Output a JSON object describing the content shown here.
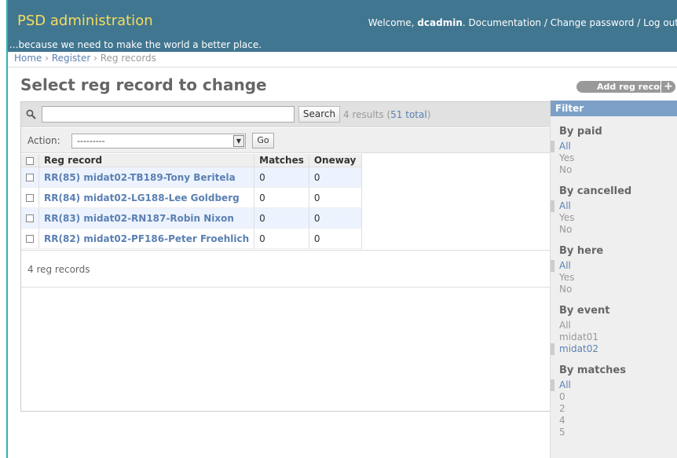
{
  "header": {
    "brand": "PSD administration",
    "tagline": "...because we need to make the world a better place.",
    "welcome": "Welcome, ",
    "username": "dcadmin",
    "links": "Documentation / Change password / Log out"
  },
  "breadcrumbs": {
    "home": "Home",
    "register": "Register",
    "current": "Reg records",
    "sep": " › "
  },
  "page": {
    "title": "Select reg record to change",
    "add_label": "Add reg record",
    "add_icon": "+"
  },
  "search": {
    "value": "",
    "button": "Search",
    "results_prefix": "4 results (",
    "total": "51 total",
    "results_suffix": ")"
  },
  "actions": {
    "label": "Action:",
    "selected": "---------",
    "go": "Go"
  },
  "table": {
    "headers": [
      "Reg record",
      "Matches",
      "Oneway"
    ],
    "rows": [
      {
        "record": "RR(85) midat02-TB189-Tony Beritela",
        "matches": "0",
        "oneway": "0"
      },
      {
        "record": "RR(84) midat02-LG188-Lee Goldberg",
        "matches": "0",
        "oneway": "0"
      },
      {
        "record": "RR(83) midat02-RN187-Robin Nixon",
        "matches": "0",
        "oneway": "0"
      },
      {
        "record": "RR(82) midat02-PF186-Peter Froehlich",
        "matches": "0",
        "oneway": "0"
      }
    ],
    "count_text": "4 reg records"
  },
  "filter": {
    "title": "Filter",
    "groups": [
      {
        "heading": "By paid",
        "options": [
          "All",
          "Yes",
          "No"
        ],
        "selected": 0
      },
      {
        "heading": "By cancelled",
        "options": [
          "All",
          "Yes",
          "No"
        ],
        "selected": 0
      },
      {
        "heading": "By here",
        "options": [
          "All",
          "Yes",
          "No"
        ],
        "selected": 0
      },
      {
        "heading": "By event",
        "options": [
          "All",
          "midat01",
          "midat02"
        ],
        "selected": 2
      },
      {
        "heading": "By matches",
        "options": [
          "All",
          "0",
          "2",
          "4",
          "5"
        ],
        "selected": 0
      }
    ]
  },
  "colors": {
    "header_bg": "#417690",
    "brand": "#f5dd5d",
    "link": "#5b80b2",
    "filter_head": "#7ca0c7"
  }
}
